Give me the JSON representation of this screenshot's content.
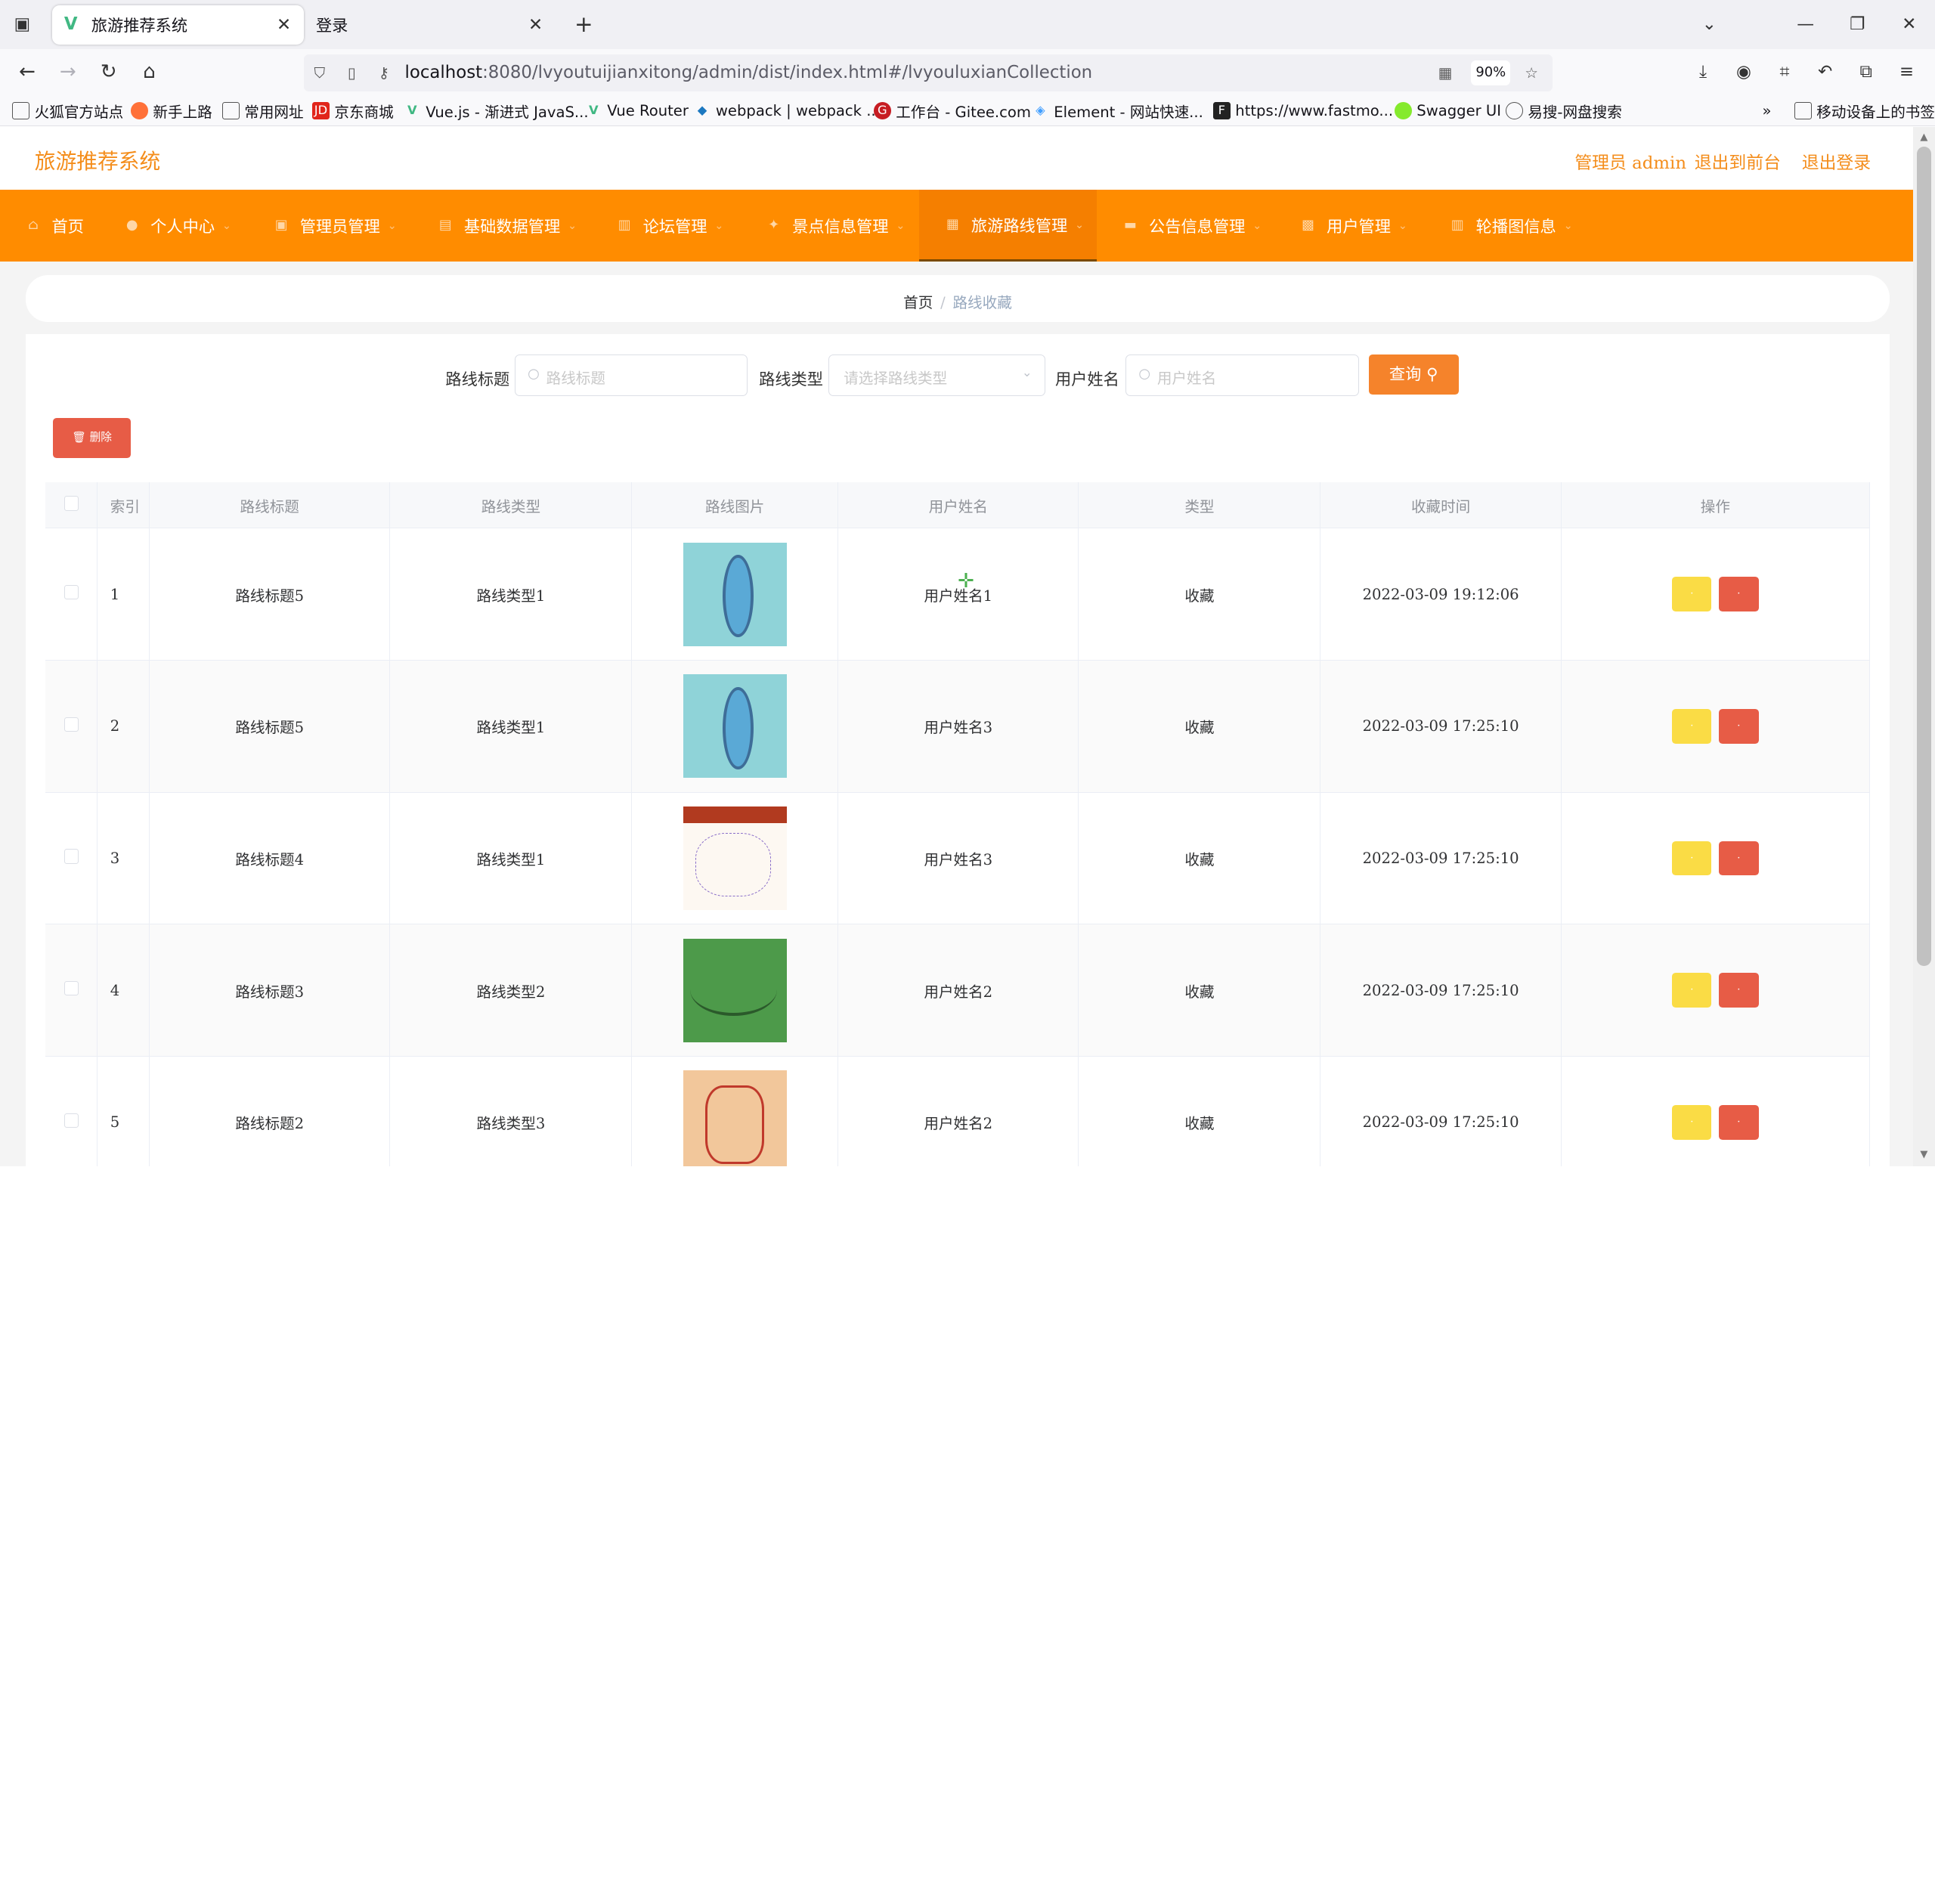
{
  "browser": {
    "tabs": [
      {
        "title": "旅游推荐系统",
        "active": true,
        "favicon": "vue-logo-icon"
      },
      {
        "title": "登录",
        "active": false
      }
    ],
    "url_host": "localhost",
    "url_rest": ":8080/lvyoutuijianxitong/admin/dist/index.html#/lvyouluxianCollection",
    "zoom": "90%",
    "bookmarks": [
      "火狐官方站点",
      "新手上路",
      "常用网址",
      "京东商城",
      "Vue.js - 渐进式 JavaS...",
      "Vue Router",
      "webpack | webpack ...",
      "工作台 - Gitee.com",
      "Element - 网站快速...",
      "https://www.fastmo...",
      "Swagger UI",
      "易搜-网盘搜索"
    ],
    "mobile_bookmarks": "移动设备上的书签"
  },
  "header": {
    "brand": "旅游推荐系统",
    "user_label": "管理员 admin",
    "to_front": "退出到前台",
    "logout": "退出登录"
  },
  "menu": [
    {
      "label": "首页",
      "has_caret": false
    },
    {
      "label": "个人中心",
      "has_caret": true
    },
    {
      "label": "管理员管理",
      "has_caret": true
    },
    {
      "label": "基础数据管理",
      "has_caret": true
    },
    {
      "label": "论坛管理",
      "has_caret": true
    },
    {
      "label": "景点信息管理",
      "has_caret": true
    },
    {
      "label": "旅游路线管理",
      "has_caret": true,
      "active": true
    },
    {
      "label": "公告信息管理",
      "has_caret": true
    },
    {
      "label": "用户管理",
      "has_caret": true
    },
    {
      "label": "轮播图信息",
      "has_caret": true
    }
  ],
  "breadcrumb": {
    "home": "首页",
    "current": "路线收藏"
  },
  "filters": {
    "title_label": "路线标题",
    "title_placeholder": "路线标题",
    "type_label": "路线类型",
    "type_placeholder": "请选择路线类型",
    "user_label": "用户姓名",
    "user_placeholder": "用户姓名",
    "search_button": "查询"
  },
  "delete_button": "删除",
  "table": {
    "columns": [
      "索引",
      "路线标题",
      "路线类型",
      "路线图片",
      "用户姓名",
      "类型",
      "收藏时间",
      "操作"
    ],
    "rows": [
      {
        "index": "1",
        "title": "路线标题5",
        "type": "路线类型1",
        "image": "lake-map",
        "user": "用户姓名1",
        "kind": "收藏",
        "time": "2022-03-09 19:12:06"
      },
      {
        "index": "2",
        "title": "路线标题5",
        "type": "路线类型1",
        "image": "lake-map",
        "user": "用户姓名3",
        "kind": "收藏",
        "time": "2022-03-09 17:25:10"
      },
      {
        "index": "3",
        "title": "路线标题4",
        "type": "路线类型1",
        "image": "route-map",
        "user": "用户姓名3",
        "kind": "收藏",
        "time": "2022-03-09 17:25:10"
      },
      {
        "index": "4",
        "title": "路线标题3",
        "type": "路线类型2",
        "image": "green-map",
        "user": "用户姓名2",
        "kind": "收藏",
        "time": "2022-03-09 17:25:10"
      },
      {
        "index": "5",
        "title": "路线标题2",
        "type": "路线类型3",
        "image": "old-map",
        "user": "用户姓名2",
        "kind": "收藏",
        "time": "2022-03-09 17:25:10"
      }
    ]
  },
  "colors": {
    "accent": "#ff8c00",
    "brand_text": "#f48d1b",
    "view_button": "#fadc45",
    "delete_button": "#e75c46"
  }
}
